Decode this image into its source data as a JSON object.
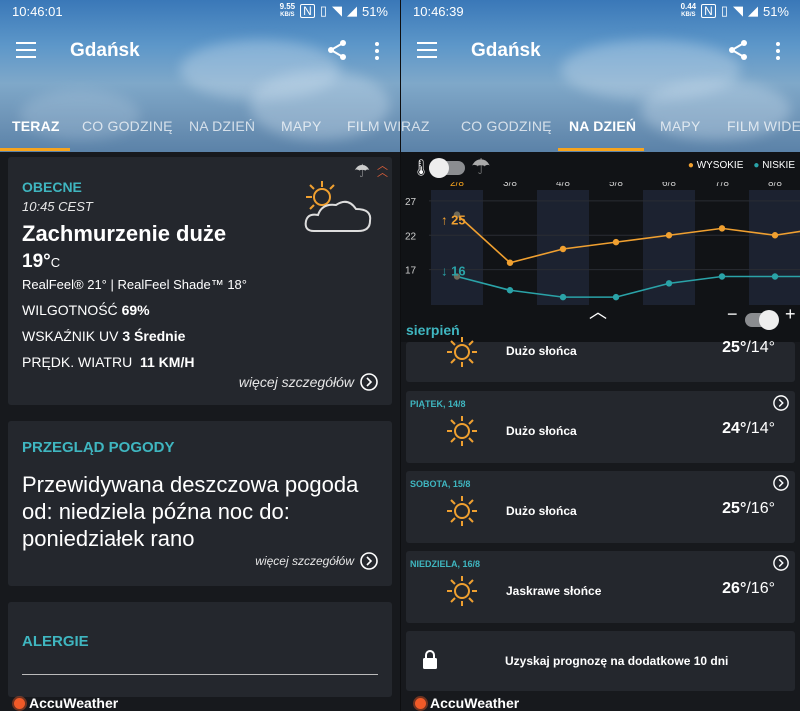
{
  "left": {
    "status": {
      "time": "10:46:01",
      "net_value": "9.55",
      "net_unit": "KB/S",
      "battery": "51%"
    },
    "app_title": "Gdańsk",
    "tabs": [
      "TERAZ",
      "CO GODZINĘ",
      "NA DZIEŃ",
      "MAPY",
      "FILM WI"
    ],
    "current": {
      "heading": "OBECNE",
      "time": "10:45 CEST",
      "phrase": "Zachmurzenie duże",
      "temp": "19°",
      "temp_unit": "C",
      "realfeel": "RealFeel® 21° | RealFeel Shade™ 18°",
      "humidity_label": "WILGOTNOŚĆ",
      "humidity_value": "69%",
      "uv_label": "WSKAŹNIK UV",
      "uv_value": "3 Średnie",
      "wind_label": "PRĘDK. WIATRU",
      "wind_value": "11 KM/H",
      "more_link": "więcej szczegółów"
    },
    "overview": {
      "heading": "PRZEGLĄD POGODY",
      "text_line1": "Przewidywana deszczowa pogoda",
      "text_line2": "od: niedziela późna noc do:",
      "text_line3": "poniedziałek rano",
      "more_link": "więcej szczegółów"
    },
    "allergies": {
      "heading": "ALERGIE"
    },
    "footer_brand": "AccuWeather"
  },
  "right": {
    "status": {
      "time": "10:46:39",
      "net_value": "0.44",
      "net_unit": "KB/S",
      "battery": "51%"
    },
    "app_title": "Gdańsk",
    "tabs": [
      "RAZ",
      "CO GODZINĘ",
      "NA DZIEŃ",
      "MAPY",
      "FILM WIDEO"
    ],
    "legend_high": "WYSOKIE",
    "legend_low": "NISKIE",
    "month_label": "sierpień",
    "days_bar": [
      {
        "label": "Dużo słońca",
        "temp_high": "25°",
        "temp_low": "/14°"
      },
      {
        "date": "PIĄTEK, 14/8",
        "label": "Dużo słońca",
        "temp_high": "24°",
        "temp_low": "/14°"
      },
      {
        "date": "SOBOTA, 15/8",
        "label": "Dużo słońca",
        "temp_high": "25°",
        "temp_low": "/16°"
      },
      {
        "date": "NIEDZIELA, 16/8",
        "label": "Jaskrawe słońce",
        "temp_high": "26°",
        "temp_low": "/16°"
      }
    ],
    "premium_text": "Uzyskaj prognozę na dodatkowe 10 dni",
    "footer_brand": "AccuWeather",
    "colors": {
      "high": "#f0a030",
      "low": "#2aa3a8",
      "accent": "#f7a41d"
    }
  },
  "chart_data": {
    "type": "line",
    "x": [
      "2/8",
      "3/8",
      "4/8",
      "5/8",
      "6/8",
      "7/8",
      "8/8"
    ],
    "series": [
      {
        "name": "WYSOKIE",
        "values": [
          25,
          18,
          20,
          21,
          22,
          23,
          22
        ]
      },
      {
        "name": "NISKIE",
        "values": [
          16,
          14,
          13,
          13,
          15,
          16,
          16
        ]
      }
    ],
    "highlight_labels": {
      "high": "25",
      "low": "16"
    },
    "y_ticks": [
      "27",
      "22",
      "17"
    ],
    "ylim": [
      12,
      28
    ]
  }
}
